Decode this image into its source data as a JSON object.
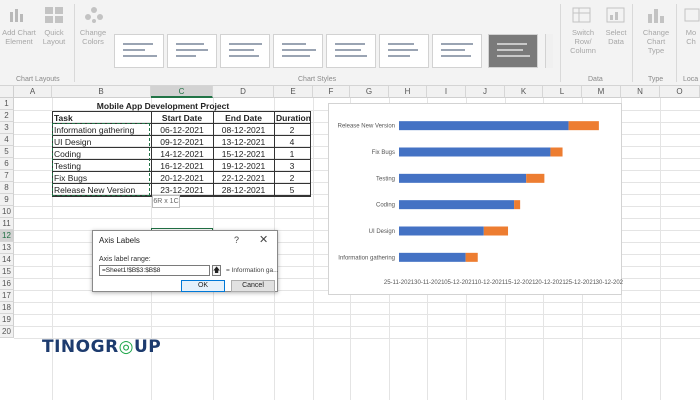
{
  "ribbon": {
    "add_chart_element": "Add Chart Element",
    "quick_layout": "Quick Layout",
    "change_colors": "Change Colors",
    "switch_row_column": "Switch Row/ Column",
    "select_data": "Select Data",
    "change_chart_type": "Change Chart Type",
    "move_chart": "Mo Ch",
    "group_chart_layouts": "Chart Layouts",
    "group_chart_styles": "Chart Styles",
    "group_data": "Data",
    "group_type": "Type",
    "group_location": "Loca"
  },
  "sheet": {
    "columns": [
      "A",
      "B",
      "C",
      "D",
      "E",
      "F",
      "G",
      "H",
      "I",
      "J",
      "K",
      "L",
      "M",
      "N",
      "O"
    ],
    "rows": [
      "1",
      "2",
      "3",
      "4",
      "5",
      "6",
      "7",
      "8",
      "9",
      "10",
      "11",
      "12",
      "13",
      "14",
      "15",
      "16",
      "17",
      "18",
      "19",
      "20"
    ],
    "title": "Mobile App Development Project",
    "headers": [
      "Task",
      "Start Date",
      "End Date",
      "Duration"
    ],
    "table": [
      [
        "Information gathering",
        "06-12-2021",
        "08-12-2021",
        "2"
      ],
      [
        "UI Design",
        "09-12-2021",
        "13-12-2021",
        "4"
      ],
      [
        "Coding",
        "14-12-2021",
        "15-12-2021",
        "1"
      ],
      [
        "Testing",
        "16-12-2021",
        "19-12-2021",
        "3"
      ],
      [
        "Fix Bugs",
        "20-12-2021",
        "22-12-2021",
        "2"
      ],
      [
        "Release New Version",
        "23-12-2021",
        "28-12-2021",
        "5"
      ]
    ],
    "size_tip": "6R x 1C"
  },
  "dialog": {
    "title": "Axis Labels",
    "help": "?",
    "close": "✕",
    "range_label": "Axis label range:",
    "range_value": "=Sheet1!$B$3:$B$8",
    "preview": "= Information ga...",
    "ok": "OK",
    "cancel": "Cancel"
  },
  "chart_data": {
    "type": "bar",
    "orientation": "horizontal-stacked",
    "categories": [
      "Information gathering",
      "UI Design",
      "Coding",
      "Testing",
      "Fix Bugs",
      "Release New Version"
    ],
    "x_ticks": [
      "25-11-2021",
      "30-11-2021",
      "05-12-2021",
      "10-12-2021",
      "15-12-2021",
      "20-12-2021",
      "25-12-2021",
      "30-12-2021"
    ],
    "series": [
      {
        "values": [
          "06-12-2021",
          "09-12-2021",
          "14-12-2021",
          "16-12-2021",
          "20-12-2021",
          "23-12-2021"
        ],
        "color": "#4472c4"
      },
      {
        "values": [
          2,
          4,
          1,
          3,
          2,
          5
        ],
        "color": "#ed7d31"
      }
    ],
    "xlim": [
      "25-11-2021",
      "30-12-2021"
    ],
    "grid": false,
    "legend": "none"
  },
  "logo": {
    "part1": "TINO",
    "part2": "GR",
    "part3": "UP"
  }
}
